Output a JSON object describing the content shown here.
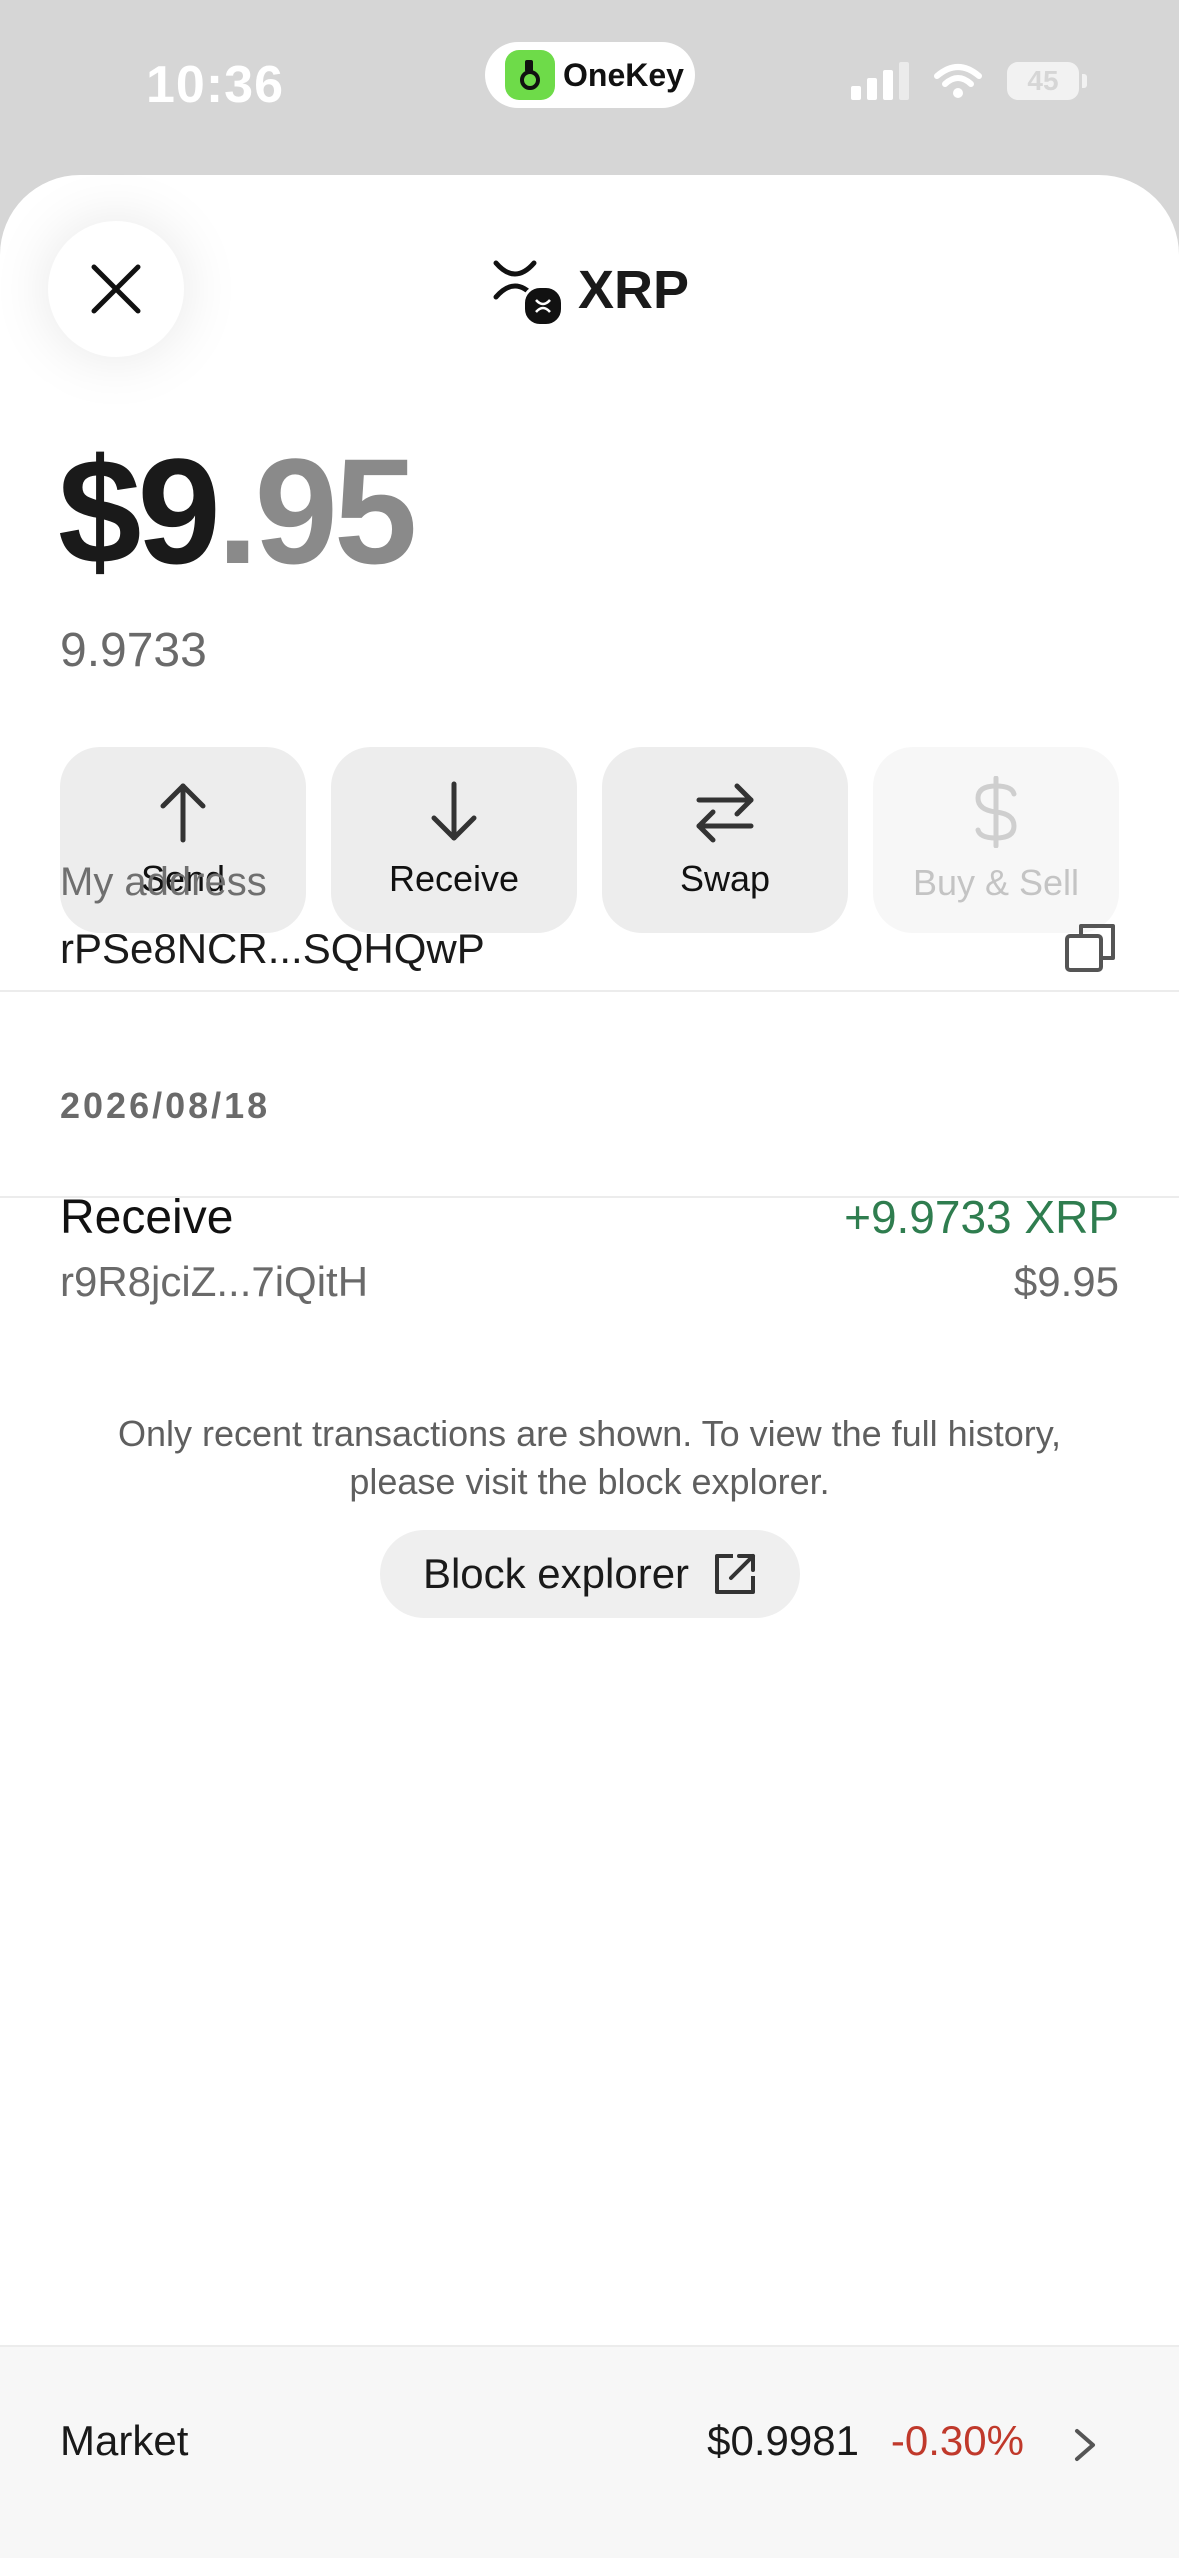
{
  "status_bar": {
    "time": "10:36",
    "app_pill": "OneKey",
    "battery": "45"
  },
  "header": {
    "title": "XRP"
  },
  "balance": {
    "int_part": "$9",
    "dec_part": ".95",
    "token_amount": "9.9733"
  },
  "actions": [
    {
      "label": "Send",
      "icon": "arrow-up-icon",
      "enabled": true
    },
    {
      "label": "Receive",
      "icon": "arrow-down-icon",
      "enabled": true
    },
    {
      "label": "Swap",
      "icon": "swap-icon",
      "enabled": true
    },
    {
      "label": "Buy & Sell",
      "icon": "dollar-icon",
      "enabled": false
    }
  ],
  "address": {
    "label": "My address",
    "value": "rPSe8NCR...SQHQwP"
  },
  "history": {
    "date": "2026/08/18",
    "items": [
      {
        "type": "Receive",
        "counterparty": "r9R8jciZ...7iQitH",
        "amount": "+9.9733 XRP",
        "usd": "$9.95"
      }
    ],
    "note": "Only recent transactions are shown. To view the full history, please visit the block explorer.",
    "explorer_label": "Block explorer"
  },
  "market": {
    "label": "Market",
    "price": "$0.9981",
    "change": "-0.30%"
  },
  "colors": {
    "positive": "#2f7d4f",
    "negative": "#c0392b",
    "brand_green": "#6edb49"
  }
}
